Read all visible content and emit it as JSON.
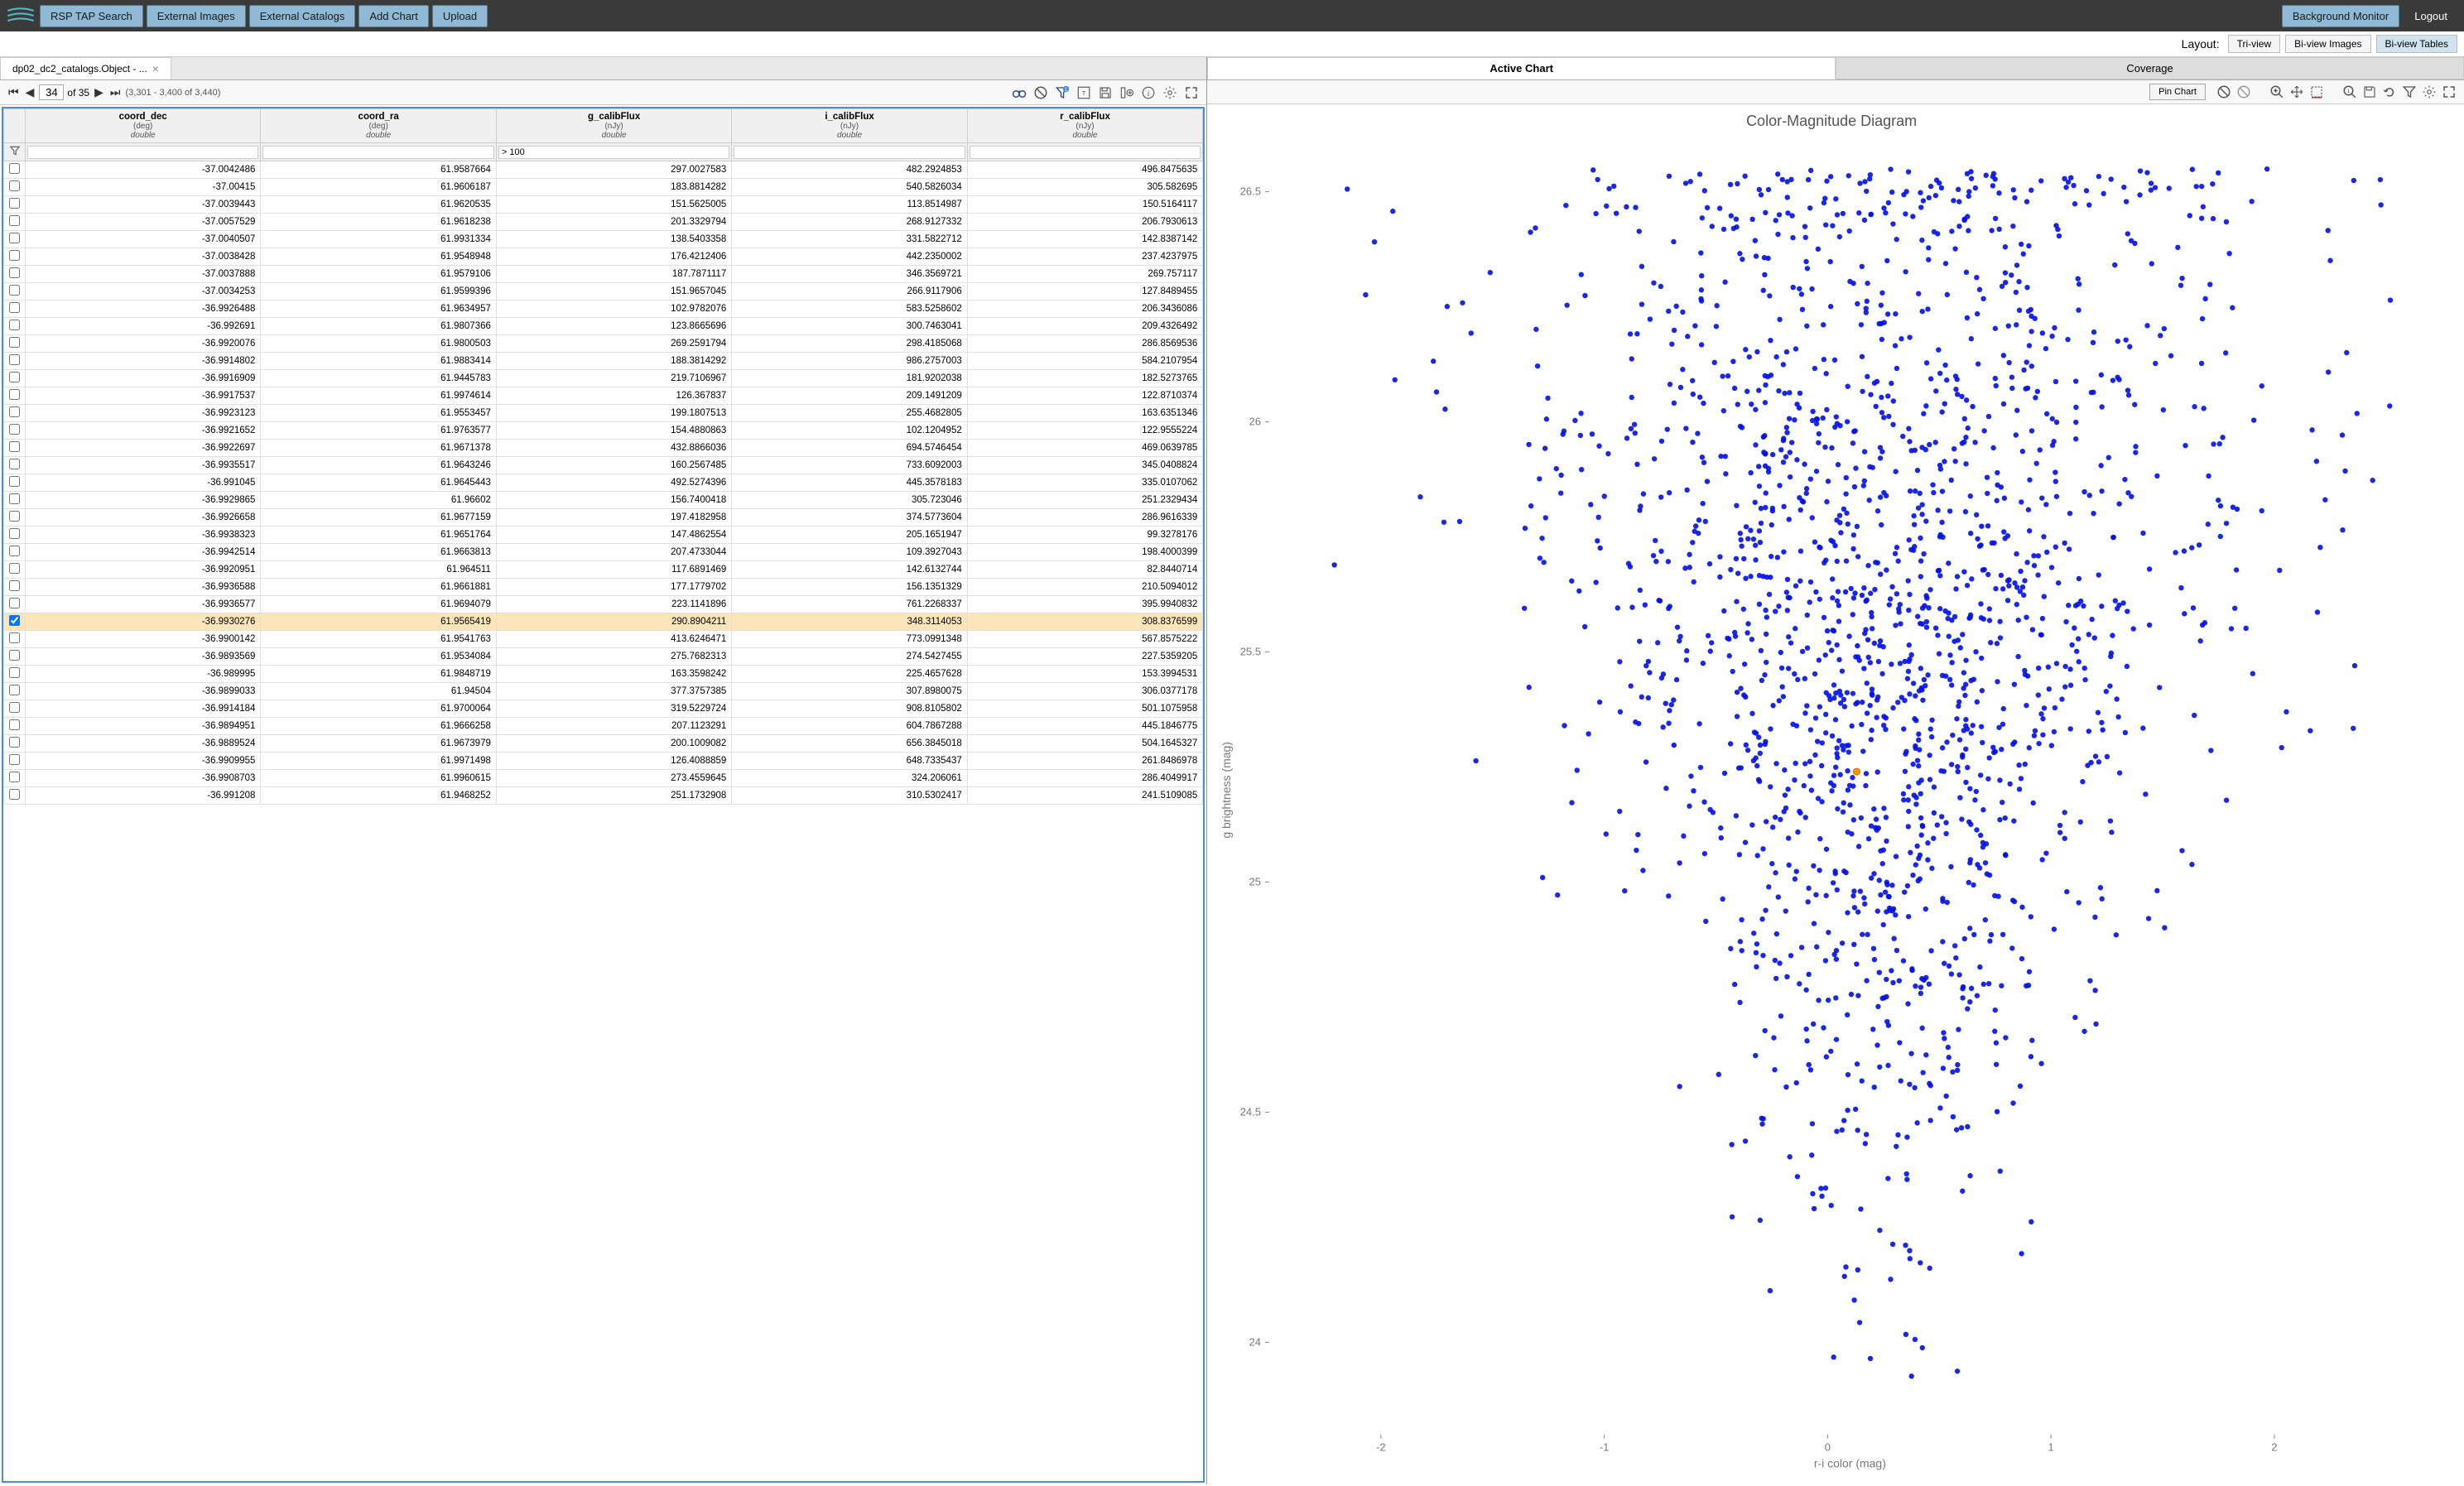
{
  "header": {
    "nav": [
      "RSP TAP Search",
      "External Images",
      "External Catalogs",
      "Add Chart",
      "Upload"
    ],
    "bg_monitor": "Background Monitor",
    "logout": "Logout"
  },
  "layout": {
    "label": "Layout:",
    "options": [
      "Tri-view",
      "Bi-view Images",
      "Bi-view Tables"
    ],
    "active": "Bi-view Tables"
  },
  "table_tab": {
    "title": "dp02_dc2_catalogs.Object - ..."
  },
  "pager": {
    "page": "34",
    "of": "of 35",
    "range": "(3,301 - 3,400 of 3,440)"
  },
  "columns": [
    {
      "name": "coord_dec",
      "unit": "(deg)",
      "type": "double"
    },
    {
      "name": "coord_ra",
      "unit": "(deg)",
      "type": "double"
    },
    {
      "name": "g_calibFlux",
      "unit": "(nJy)",
      "type": "double"
    },
    {
      "name": "i_calibFlux",
      "unit": "(nJy)",
      "type": "double"
    },
    {
      "name": "r_calibFlux",
      "unit": "(nJy)",
      "type": "double"
    }
  ],
  "filters": [
    "",
    "",
    "> 100",
    "",
    ""
  ],
  "rows": [
    {
      "sel": false,
      "v": [
        "-37.0042486",
        "61.9587664",
        "297.0027583",
        "482.2924853",
        "496.8475635"
      ]
    },
    {
      "sel": false,
      "v": [
        "-37.00415",
        "61.9606187",
        "183.8814282",
        "540.5826034",
        "305.582695"
      ]
    },
    {
      "sel": false,
      "v": [
        "-37.0039443",
        "61.9620535",
        "151.5625005",
        "113.8514987",
        "150.5164117"
      ]
    },
    {
      "sel": false,
      "v": [
        "-37.0057529",
        "61.9618238",
        "201.3329794",
        "268.9127332",
        "206.7930613"
      ]
    },
    {
      "sel": false,
      "v": [
        "-37.0040507",
        "61.9931334",
        "138.5403358",
        "331.5822712",
        "142.8387142"
      ]
    },
    {
      "sel": false,
      "v": [
        "-37.0038428",
        "61.9548948",
        "176.4212406",
        "442.2350002",
        "237.4237975"
      ]
    },
    {
      "sel": false,
      "v": [
        "-37.0037888",
        "61.9579106",
        "187.7871117",
        "346.3569721",
        "269.757117"
      ]
    },
    {
      "sel": false,
      "v": [
        "-37.0034253",
        "61.9599396",
        "151.9657045",
        "266.9117906",
        "127.8489455"
      ]
    },
    {
      "sel": false,
      "v": [
        "-36.9926488",
        "61.9634957",
        "102.9782076",
        "583.5258602",
        "206.3436086"
      ]
    },
    {
      "sel": false,
      "v": [
        "-36.992691",
        "61.9807366",
        "123.8665696",
        "300.7463041",
        "209.4326492"
      ]
    },
    {
      "sel": false,
      "v": [
        "-36.9920076",
        "61.9800503",
        "269.2591794",
        "298.4185068",
        "286.8569536"
      ]
    },
    {
      "sel": false,
      "v": [
        "-36.9914802",
        "61.9883414",
        "188.3814292",
        "986.2757003",
        "584.2107954"
      ]
    },
    {
      "sel": false,
      "v": [
        "-36.9916909",
        "61.9445783",
        "219.7106967",
        "181.9202038",
        "182.5273765"
      ]
    },
    {
      "sel": false,
      "v": [
        "-36.9917537",
        "61.9974614",
        "126.367837",
        "209.1491209",
        "122.8710374"
      ]
    },
    {
      "sel": false,
      "v": [
        "-36.9923123",
        "61.9553457",
        "199.1807513",
        "255.4682805",
        "163.6351346"
      ]
    },
    {
      "sel": false,
      "v": [
        "-36.9921652",
        "61.9763577",
        "154.4880863",
        "102.1204952",
        "122.9555224"
      ]
    },
    {
      "sel": false,
      "v": [
        "-36.9922697",
        "61.9671378",
        "432.8866036",
        "694.5746454",
        "469.0639785"
      ]
    },
    {
      "sel": false,
      "v": [
        "-36.9935517",
        "61.9643246",
        "160.2567485",
        "733.6092003",
        "345.0408824"
      ]
    },
    {
      "sel": false,
      "v": [
        "-36.991045",
        "61.9645443",
        "492.5274396",
        "445.3578183",
        "335.0107062"
      ]
    },
    {
      "sel": false,
      "v": [
        "-36.9929865",
        "61.96602",
        "156.7400418",
        "305.723046",
        "251.2329434"
      ]
    },
    {
      "sel": false,
      "v": [
        "-36.9926658",
        "61.9677159",
        "197.4182958",
        "374.5773604",
        "286.9616339"
      ]
    },
    {
      "sel": false,
      "v": [
        "-36.9938323",
        "61.9651764",
        "147.4862554",
        "205.1651947",
        "99.3278176"
      ]
    },
    {
      "sel": false,
      "v": [
        "-36.9942514",
        "61.9663813",
        "207.4733044",
        "109.3927043",
        "198.4000399"
      ]
    },
    {
      "sel": false,
      "v": [
        "-36.9920951",
        "61.964511",
        "117.6891469",
        "142.6132744",
        "82.8440714"
      ]
    },
    {
      "sel": false,
      "v": [
        "-36.9936588",
        "61.9661881",
        "177.1779702",
        "156.1351329",
        "210.5094012"
      ]
    },
    {
      "sel": false,
      "v": [
        "-36.9936577",
        "61.9694079",
        "223.1141896",
        "761.2268337",
        "395.9940832"
      ]
    },
    {
      "sel": true,
      "v": [
        "-36.9930276",
        "61.9565419",
        "290.8904211",
        "348.3114053",
        "308.8376599"
      ]
    },
    {
      "sel": false,
      "v": [
        "-36.9900142",
        "61.9541763",
        "413.6246471",
        "773.0991348",
        "567.8575222"
      ]
    },
    {
      "sel": false,
      "v": [
        "-36.9893569",
        "61.9534084",
        "275.7682313",
        "274.5427455",
        "227.5359205"
      ]
    },
    {
      "sel": false,
      "v": [
        "-36.989995",
        "61.9848719",
        "163.3598242",
        "225.4657628",
        "153.3994531"
      ]
    },
    {
      "sel": false,
      "v": [
        "-36.9899033",
        "61.94504",
        "377.3757385",
        "307.8980075",
        "306.0377178"
      ]
    },
    {
      "sel": false,
      "v": [
        "-36.9914184",
        "61.9700064",
        "319.5229724",
        "908.8105802",
        "501.1075958"
      ]
    },
    {
      "sel": false,
      "v": [
        "-36.9894951",
        "61.9666258",
        "207.1123291",
        "604.7867288",
        "445.1846775"
      ]
    },
    {
      "sel": false,
      "v": [
        "-36.9889524",
        "61.9673979",
        "200.1009082",
        "656.3845018",
        "504.1645327"
      ]
    },
    {
      "sel": false,
      "v": [
        "-36.9909955",
        "61.9971498",
        "126.4088859",
        "648.7335437",
        "261.8486978"
      ]
    },
    {
      "sel": false,
      "v": [
        "-36.9908703",
        "61.9960615",
        "273.4559645",
        "324.206061",
        "286.4049917"
      ]
    },
    {
      "sel": false,
      "v": [
        "-36.991208",
        "61.9468252",
        "251.1732908",
        "310.5302417",
        "241.5109085"
      ]
    }
  ],
  "chart_tabs": {
    "tabs": [
      "Active Chart",
      "Coverage"
    ],
    "active": "Active Chart"
  },
  "pin_chart": "Pin Chart",
  "chart_data": {
    "type": "scatter",
    "title": "Color-Magnitude Diagram",
    "xlabel": "r-i color (mag)",
    "ylabel": "g brightness (mag)",
    "xlim": [
      -2.5,
      2.7
    ],
    "ylim": [
      26.6,
      23.8
    ],
    "xticks": [
      -2,
      -1,
      0,
      1,
      2
    ],
    "yticks": [
      24,
      24.5,
      25,
      25.5,
      26,
      26.5
    ],
    "highlight": {
      "x": 0.13,
      "y": 25.24
    },
    "n_points": 1800,
    "distribution": "normal_cone",
    "x_center": 0.25,
    "x_sigma": 0.55,
    "y_center": 25.6,
    "y_sigma": 0.6
  }
}
